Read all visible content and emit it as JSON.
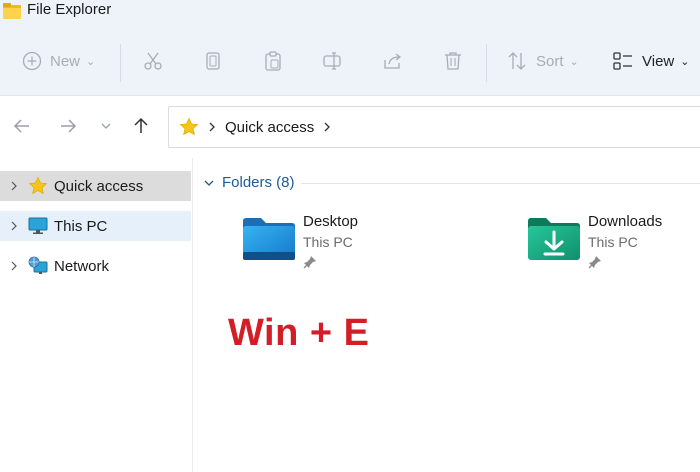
{
  "window": {
    "title": "File Explorer"
  },
  "toolbar": {
    "new_label": "New",
    "sort_label": "Sort",
    "view_label": "View"
  },
  "address": {
    "crumbs": [
      "Quick access"
    ]
  },
  "sidebar": {
    "items": [
      {
        "label": "Quick access",
        "icon": "star-icon",
        "state": "selected"
      },
      {
        "label": "This PC",
        "icon": "monitor-icon",
        "state": "hover"
      },
      {
        "label": "Network",
        "icon": "network-icon",
        "state": "normal"
      }
    ]
  },
  "content": {
    "group_title": "Folders (8)",
    "folders": [
      {
        "name": "Desktop",
        "location": "This PC",
        "icon": "desktop-folder-icon",
        "pinned": true
      },
      {
        "name": "Downloads",
        "location": "This PC",
        "icon": "downloads-folder-icon",
        "pinned": true
      }
    ]
  },
  "overlay": {
    "text": "Win + E"
  },
  "colors": {
    "accent": "#1f5a96",
    "overlay_red": "#d21e26",
    "toolbar_bg": "#eef3fa"
  }
}
